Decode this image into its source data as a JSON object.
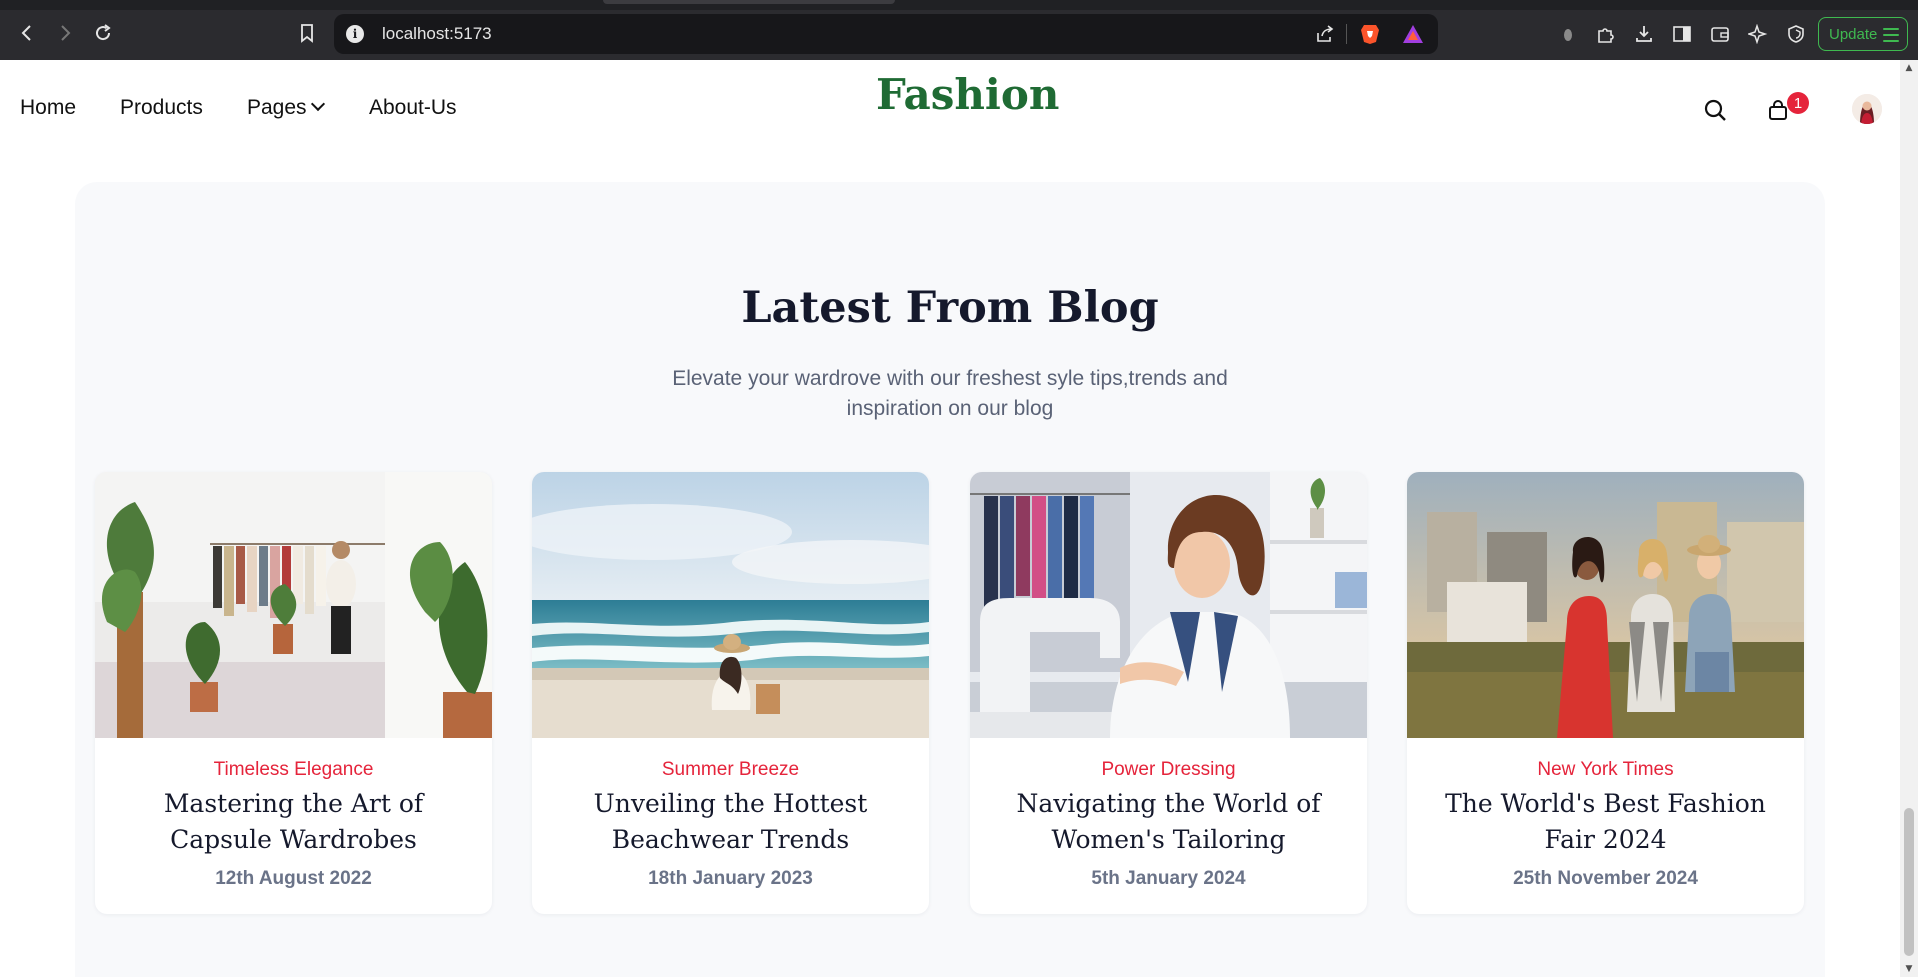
{
  "browser": {
    "url": "localhost:5173",
    "update_label": "Update"
  },
  "nav": {
    "links": [
      "Home",
      "Products",
      "Pages",
      "About-Us"
    ],
    "brand": "Fashion",
    "cart_count": "1"
  },
  "blog": {
    "title": "Latest From Blog",
    "subtitle": "Elevate your wardrove with our freshest syle tips,trends and inspiration on our blog",
    "posts": [
      {
        "category": "Timeless Elegance",
        "title": "Mastering the Art of Capsule Wardrobes",
        "date": "12th August 2022"
      },
      {
        "category": "Summer Breeze",
        "title": "Unveiling the Hottest Beachwear Trends",
        "date": "18th January 2023"
      },
      {
        "category": "Power Dressing",
        "title": "Navigating the World of Women's Tailoring",
        "date": "5th January 2024"
      },
      {
        "category": "New York Times",
        "title": "The World's Best Fashion Fair 2024",
        "date": "25th November 2024"
      }
    ]
  },
  "colors": {
    "brand": "#1f6b34",
    "accent": "#e5243b",
    "update_green": "#3fb950"
  }
}
